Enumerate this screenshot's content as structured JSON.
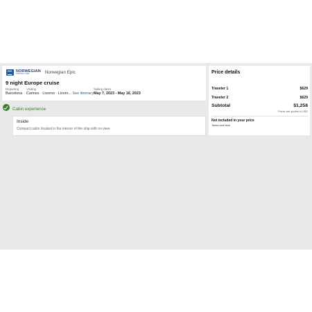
{
  "brand": {
    "name": "NORWEGIAN",
    "sub": "CRUISE LINE",
    "logo_icon": "norwegian-logo-icon",
    "color": "#1f5fa8"
  },
  "trip": {
    "ship": "Norwegian Epic",
    "title": "9 night Europe cruise",
    "departing_label": "Departing",
    "departing_value": "Barcelona",
    "visiting_label": "Visiting",
    "visiting_value": "Cannes · Livorno · Livorn...",
    "itinerary_link": "See itinerary",
    "dates_label": "Sailing dates",
    "dates_value": "May 7, 2023 - May 16, 2023"
  },
  "cabin": {
    "section_label": "Cabin experience",
    "check_icon": "check-circle-icon",
    "accent_color": "#3e7d2a",
    "type": "Inside",
    "description": "Compact cabin located in the interior of the ship with no view."
  },
  "price": {
    "heading": "Price details",
    "rows": [
      {
        "label": "Traveler 1",
        "value": "$629"
      },
      {
        "label": "Traveler 2",
        "value": "$629"
      }
    ],
    "subtotal_label": "Subtotal",
    "subtotal_value": "$1,258",
    "currency_note": "Prices are quoted in USD",
    "not_included_heading": "Not included in your price",
    "not_included_item": "Taxes and fees"
  }
}
